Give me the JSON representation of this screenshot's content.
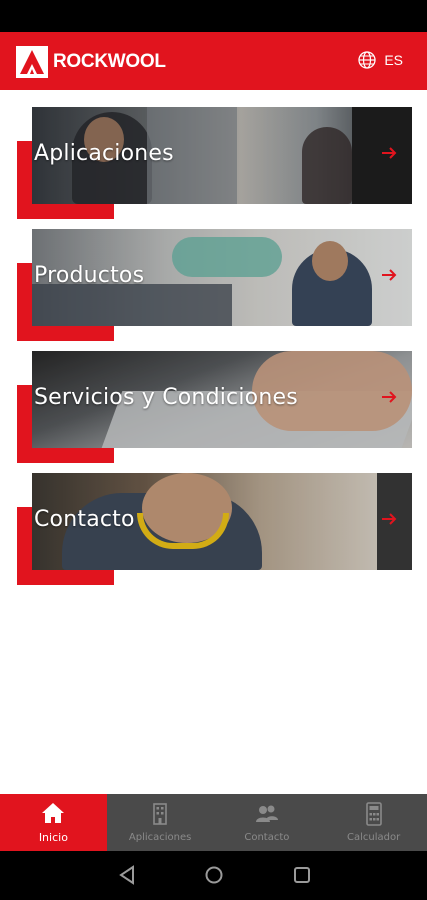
{
  "header": {
    "brand": "ROCKWOOL",
    "language": "ES"
  },
  "cards": [
    {
      "label": "Aplicaciones"
    },
    {
      "label": "Productos"
    },
    {
      "label": "Servicios y Condiciones"
    },
    {
      "label": "Contacto"
    }
  ],
  "bottom_nav": [
    {
      "label": "Inicio",
      "icon": "home-icon",
      "active": true
    },
    {
      "label": "Aplicaciones",
      "icon": "building-icon",
      "active": false
    },
    {
      "label": "Contacto",
      "icon": "contacts-icon",
      "active": false
    },
    {
      "label": "Calculador",
      "icon": "calculator-icon",
      "active": false
    }
  ],
  "colors": {
    "brand_red": "#e1141e",
    "nav_bg": "#4a4a4a"
  }
}
